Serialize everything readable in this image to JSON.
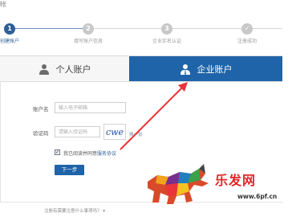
{
  "header_fragment": "帐",
  "progress": {
    "steps": [
      {
        "num": "1",
        "label": "创建账户",
        "active": true
      },
      {
        "num": "2",
        "label": "填写账户信息",
        "active": false
      },
      {
        "num": "3",
        "label": "企业实名认证",
        "active": false
      },
      {
        "num": "✓",
        "label": "注册成功",
        "active": false
      }
    ]
  },
  "tabs": {
    "personal": "个人账户",
    "company": "企业账户"
  },
  "form": {
    "account_label": "账户名",
    "account_placeholder": "输入电子邮箱",
    "captcha_label": "验证码",
    "captcha_placeholder": "请输入验证码",
    "captcha_text": "cwe",
    "refresh_text": "换一张",
    "agree_prefix": "我已阅读并同意",
    "agree_link": "服务协议",
    "agree_checked": true,
    "next_button": "下一步"
  },
  "footer": {
    "text": "注册有需要注意什么事项吗？ ▾"
  },
  "watermark": {
    "brand": "乐发网",
    "url": "www.6pf.cn"
  },
  "colors": {
    "accent": "#1f64a8",
    "arrow": "#e8343a",
    "watermark_red": "#e02828"
  }
}
